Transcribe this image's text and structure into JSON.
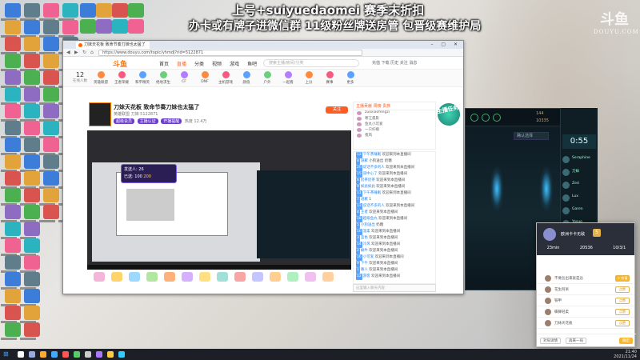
{
  "overlay": {
    "line1": "上号+suiyuedaomei 赛季末折扣",
    "line2": "办卡或有牌子进微信群 11级粉丝牌送房管 包晋级赛维护局"
  },
  "logo": {
    "main": "斗鱼",
    "sub": "DOUYU.COM"
  },
  "browser": {
    "tab_title": "刀妹天花板 致命节奏刀妹也太猛了",
    "url": "https://www.douyu.com/topic/yhmdj?rid=5122871",
    "site_logo": "斗鱼",
    "nav": [
      "首页",
      "直播",
      "分类",
      "视频",
      "游戏",
      "鱼吧"
    ],
    "search_placeholder": "搜索主播/房间/分类",
    "user_area": "充值  下载  历史  关注  消息",
    "online_count": "12",
    "online_label": "在线人数",
    "categories": [
      "英雄联盟",
      "王者荣耀",
      "和平精英",
      "绝地求生",
      "CF",
      "DNF",
      "主机游戏",
      "颜值",
      "户外",
      "一起看",
      "上分",
      "赛事",
      "更多"
    ],
    "stream": {
      "title": "刀妹天花板 致命节奏刀妹也太猛了",
      "sub1": "英雄联盟  刀妹  5122871",
      "sub2": "热度  12.4万",
      "tags": [
        "超级会员",
        "主播认证",
        "开播提醒"
      ],
      "follow": "关注"
    },
    "popup": {
      "line1_label": "发送人: 26",
      "line2_label": "已送: 100",
      "line2_value": "200"
    },
    "video_overlay": {
      "line1": "上号+suiyuedaomei 赛季末折扣",
      "line2": "子进微信群 11级粉丝牌送房管  包晋级赛维护局"
    },
    "rank": {
      "tabs": "主播贡献  周榜  贵族",
      "items": [
        "zuoxiaofengzi",
        "寒江孤影",
        "鱼丸小可爱",
        "一只柠檬",
        "夜风"
      ]
    },
    "chat": [
      {
        "lv": "12",
        "name": "下午茶睡眠",
        "msg": "欢迎来到本直播间"
      },
      {
        "lv": "8",
        "name": "道歉",
        "msg": "小狗送出 奶糖"
      },
      {
        "lv": "20",
        "name": "说话不多的人",
        "msg": "欢迎来到本直播间"
      },
      {
        "lv": "15",
        "name": "道中心了",
        "msg": "欢迎来到本直播间"
      },
      {
        "lv": "6",
        "name": "奶茶奶茶",
        "msg": "欢迎来到本直播间"
      },
      {
        "lv": "9",
        "name": "如此如此",
        "msg": "欢迎来到本直播间"
      },
      {
        "lv": "11",
        "name": "下午茶睡眠",
        "msg": "欢迎来到本直播间"
      },
      {
        "lv": "7",
        "name": "道歉",
        "msg": "1"
      },
      {
        "lv": "13",
        "name": "说话不多的人",
        "msg": "欢迎来到本直播间"
      },
      {
        "lv": "4",
        "name": "王者",
        "msg": "欢迎来到本直播间"
      },
      {
        "lv": "18",
        "name": "超级鱼丸",
        "msg": "欢迎来到本直播间"
      },
      {
        "lv": "5",
        "name": "小狗送出",
        "msg": "奶糖"
      },
      {
        "lv": "10",
        "name": "温柔",
        "msg": "欢迎来到本直播间"
      },
      {
        "lv": "3",
        "name": "蓝色",
        "msg": "欢迎来到本直播间"
      },
      {
        "lv": "14",
        "name": "冷风",
        "msg": "欢迎来到本直播间"
      },
      {
        "lv": "2",
        "name": "蜗牛",
        "msg": "欢迎来到本直播间"
      },
      {
        "lv": "16",
        "name": "小可爱",
        "msg": "欢迎来到本直播间"
      },
      {
        "lv": "9",
        "name": "下午",
        "msg": "欢迎来到本直播间"
      },
      {
        "lv": "1",
        "name": "路人",
        "msg": "欢迎来到本直播间"
      },
      {
        "lv": "12",
        "name": "游客",
        "msg": "欢迎来到本直播间"
      }
    ],
    "chat_placeholder": "这里输入聊天内容",
    "side_badge": "主播任务"
  },
  "game": {
    "numbers": [
      "144",
      "10335"
    ],
    "field": "确认选择",
    "timer": "0:55",
    "players": [
      "Seraphine",
      "刀妹",
      "Zed",
      "Lux",
      "Garen",
      "Yasuo",
      "Ahri",
      "Jinx"
    ]
  },
  "result": {
    "name": "欧洲卡卡无敌",
    "badge": "5",
    "stats": [
      "23min",
      "20536",
      "10/3/1"
    ],
    "rows": [
      {
        "name": "不要怂出来就是怂",
        "btn": "+ 申请关注"
      },
      {
        "name": "花生阿呆",
        "btn": "点赞"
      },
      {
        "name": "铁甲",
        "btn": "点赞"
      },
      {
        "name": "蝶舞轻柔",
        "btn": "点赞"
      },
      {
        "name": "刀妹天花板",
        "btn": "点赞"
      }
    ],
    "foot_left": "对局详情",
    "foot_mid": "再来一局",
    "foot_go": "确定"
  },
  "taskbar": {
    "time": "21:40",
    "date": "2021/11/24"
  }
}
